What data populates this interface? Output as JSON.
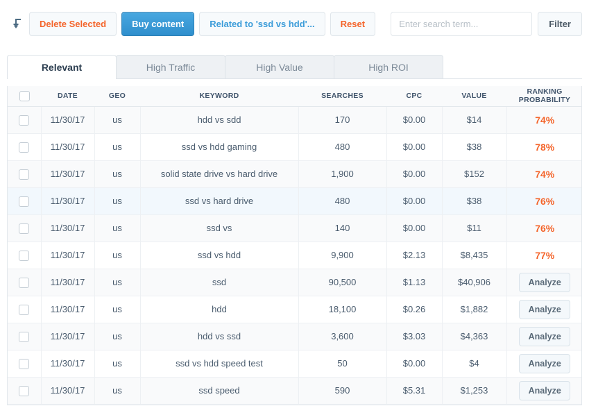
{
  "toolbar": {
    "return_icon": "return-arrow-icon",
    "delete_selected_label": "Delete Selected",
    "buy_content_label": "Buy content",
    "related_label": "Related to 'ssd vs hdd'...",
    "reset_label": "Reset",
    "search_placeholder": "Enter search term...",
    "search_value": "",
    "filter_label": "Filter"
  },
  "tabs": [
    {
      "label": "Relevant",
      "active": true
    },
    {
      "label": "High Traffic",
      "active": false
    },
    {
      "label": "High Value",
      "active": false
    },
    {
      "label": "High ROI",
      "active": false
    }
  ],
  "table": {
    "columns": [
      "",
      "DATE",
      "GEO",
      "KEYWORD",
      "SEARCHES",
      "CPC",
      "VALUE",
      "RANKING PROBABILITY"
    ],
    "rows": [
      {
        "date": "11/30/17",
        "geo": "us",
        "keyword": "hdd vs sdd",
        "searches": "170",
        "cpc": "$0.00",
        "value": "$14",
        "rank": "74%",
        "rank_type": "pct",
        "stripe": "odd",
        "hover": false
      },
      {
        "date": "11/30/17",
        "geo": "us",
        "keyword": "ssd vs hdd gaming",
        "searches": "480",
        "cpc": "$0.00",
        "value": "$38",
        "rank": "78%",
        "rank_type": "pct",
        "stripe": "even",
        "hover": false
      },
      {
        "date": "11/30/17",
        "geo": "us",
        "keyword": "solid state drive vs hard drive",
        "searches": "1,900",
        "cpc": "$0.00",
        "value": "$152",
        "rank": "74%",
        "rank_type": "pct",
        "stripe": "odd",
        "hover": false
      },
      {
        "date": "11/30/17",
        "geo": "us",
        "keyword": "ssd vs hard drive",
        "searches": "480",
        "cpc": "$0.00",
        "value": "$38",
        "rank": "76%",
        "rank_type": "pct",
        "stripe": "even",
        "hover": true
      },
      {
        "date": "11/30/17",
        "geo": "us",
        "keyword": "ssd vs",
        "searches": "140",
        "cpc": "$0.00",
        "value": "$11",
        "rank": "76%",
        "rank_type": "pct",
        "stripe": "odd",
        "hover": false
      },
      {
        "date": "11/30/17",
        "geo": "us",
        "keyword": "ssd vs hdd",
        "searches": "9,900",
        "cpc": "$2.13",
        "value": "$8,435",
        "rank": "77%",
        "rank_type": "pct",
        "stripe": "even",
        "hover": false
      },
      {
        "date": "11/30/17",
        "geo": "us",
        "keyword": "ssd",
        "searches": "90,500",
        "cpc": "$1.13",
        "value": "$40,906",
        "rank": "Analyze",
        "rank_type": "button",
        "stripe": "odd",
        "hover": false
      },
      {
        "date": "11/30/17",
        "geo": "us",
        "keyword": "hdd",
        "searches": "18,100",
        "cpc": "$0.26",
        "value": "$1,882",
        "rank": "Analyze",
        "rank_type": "button",
        "stripe": "even",
        "hover": false
      },
      {
        "date": "11/30/17",
        "geo": "us",
        "keyword": "hdd vs ssd",
        "searches": "3,600",
        "cpc": "$3.03",
        "value": "$4,363",
        "rank": "Analyze",
        "rank_type": "button",
        "stripe": "odd",
        "hover": false
      },
      {
        "date": "11/30/17",
        "geo": "us",
        "keyword": "ssd vs hdd speed test",
        "searches": "50",
        "cpc": "$0.00",
        "value": "$4",
        "rank": "Analyze",
        "rank_type": "button",
        "stripe": "even",
        "hover": false
      },
      {
        "date": "11/30/17",
        "geo": "us",
        "keyword": "ssd speed",
        "searches": "590",
        "cpc": "$5.31",
        "value": "$1,253",
        "rank": "Analyze",
        "rank_type": "button",
        "stripe": "odd",
        "hover": false
      }
    ]
  },
  "colors": {
    "accent_orange": "#f4642a",
    "accent_blue": "#3b9cd9",
    "primary_blue": "#2f8fcd",
    "text_dark": "#40546b",
    "hover_row": "#f2f8fd"
  }
}
